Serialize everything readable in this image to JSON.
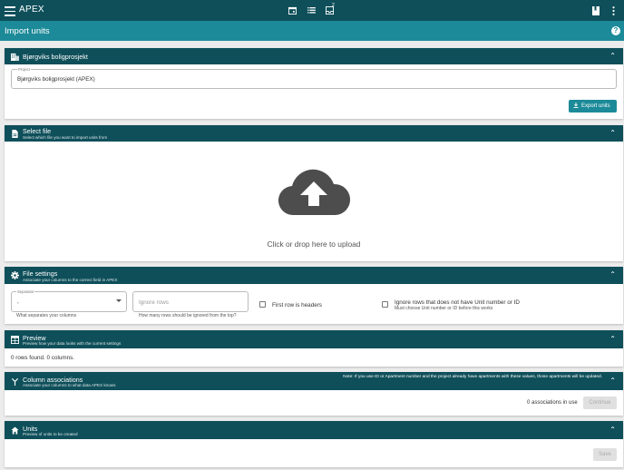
{
  "app": {
    "title": "APEX",
    "notification_count": "2"
  },
  "page": {
    "title": "Import units"
  },
  "project_panel": {
    "title": "Bjørgviks boligprosjekt",
    "project_label": "Project",
    "project_value": "Bjørgviks boligprosjekt (APEX)",
    "export_label": "Export units"
  },
  "file_panel": {
    "title": "Select file",
    "subtitle": "Select which file you want to import units from",
    "upload_text": "Click or drop here to upload"
  },
  "settings_panel": {
    "title": "File settings",
    "subtitle": "Associate your columns to the correct field in APEX",
    "separator_label": "Separator",
    "separator_value": ",",
    "separator_help": "What separates your columns",
    "ignore_rows_placeholder": "Ignore rows",
    "ignore_rows_help": "How many rows should be ignored from the top?",
    "first_row_label": "First row is headers",
    "ignore_missing_label": "Ignore rows that does not have Unit number or ID",
    "ignore_missing_help": "Must choose Unit number or ID before this works"
  },
  "preview_panel": {
    "title": "Preview",
    "subtitle": "Preview how your data looks with the current settings",
    "status": "0 rows found. 0 columns."
  },
  "assoc_panel": {
    "title": "Column associations",
    "subtitle": "Associate your columns to what data APEX knows",
    "note": "Note: If you use ID or Apartment number and the project already have apartments with these values, those apartments will be updated.",
    "count_text": "0 associations in use",
    "continue_label": "Continue"
  },
  "units_panel": {
    "title": "Units",
    "subtitle": "Preview of units to be created",
    "save_label": "Save"
  },
  "colors": {
    "dark": "#0e4f5a",
    "accent": "#1c8a98"
  }
}
